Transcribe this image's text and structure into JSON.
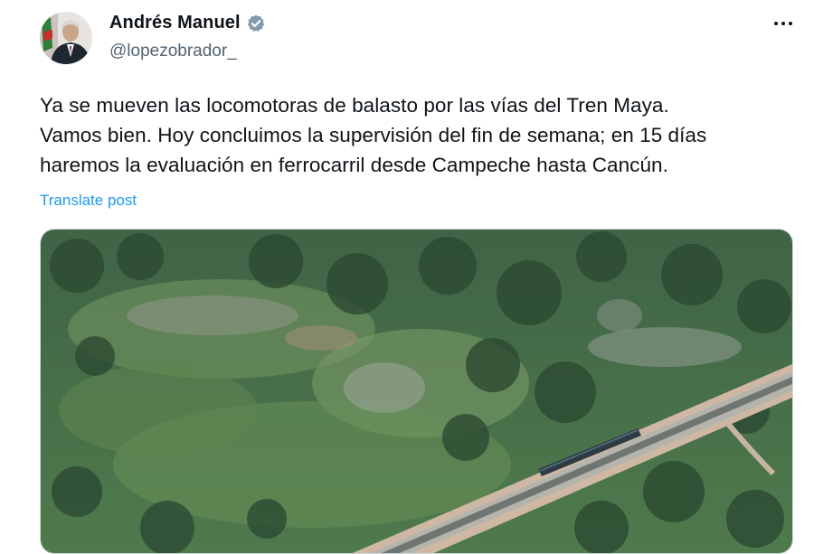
{
  "author": {
    "display_name": "Andrés Manuel",
    "handle": "@lopezobrador_",
    "verified_icon": "verified-badge-icon",
    "avatar": "avatar"
  },
  "menu": {
    "more_icon": "more-options-icon"
  },
  "tweet": {
    "lines": [
      "Ya se mueven las locomotoras de balasto por las vías del Tren Maya.",
      "Vamos bien. Hoy concluimos la supervisión del fin de semana; en 15 días",
      "haremos la evaluación en ferrocarril desde Campeche hasta Cancún."
    ],
    "translate_label": "Translate post"
  },
  "media": {
    "kind": "aerial photo of railway through vegetation"
  },
  "colors": {
    "link": "#1d9bf0",
    "text": "#0f1419",
    "secondary": "#536471",
    "verified": "#829aab"
  }
}
